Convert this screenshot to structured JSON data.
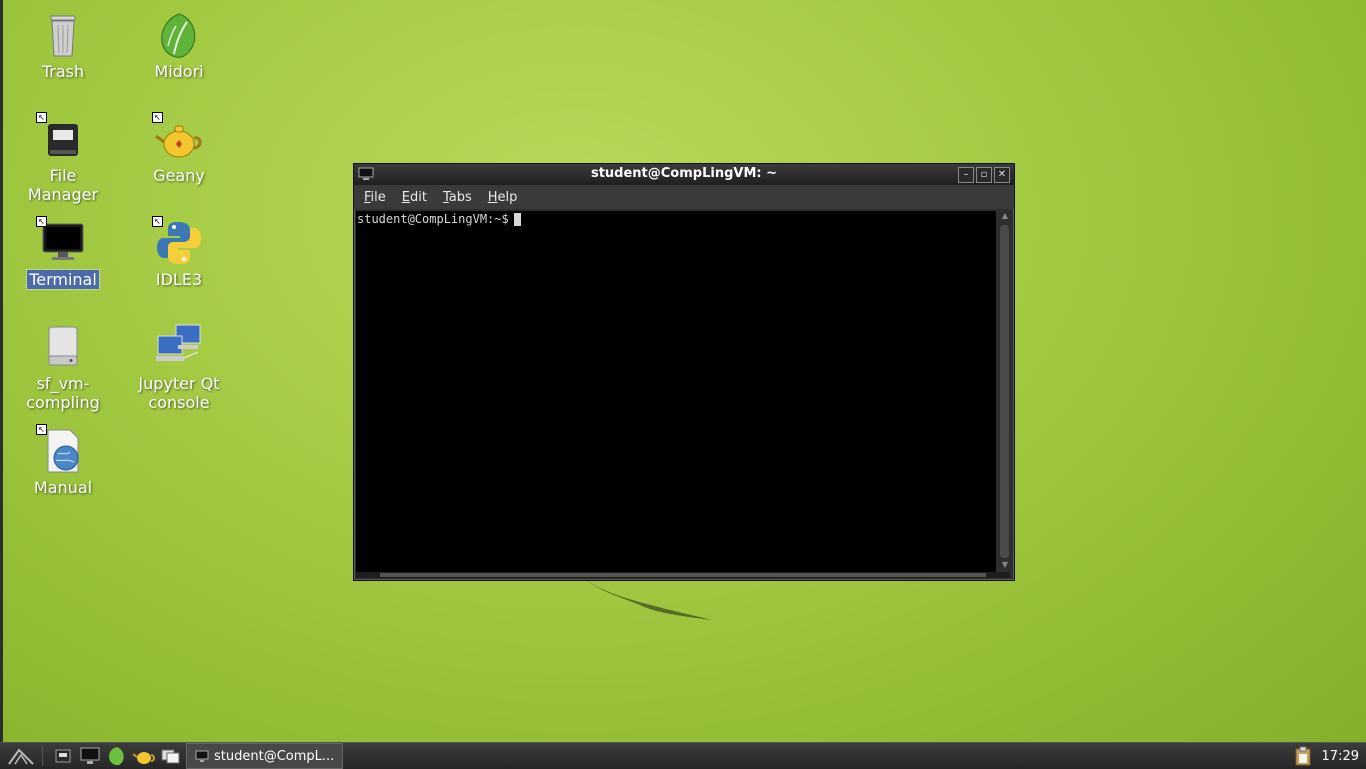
{
  "desktop": {
    "icons": [
      {
        "label": "Trash"
      },
      {
        "label": "Midori"
      },
      {
        "label": "File Manager"
      },
      {
        "label": "Geany"
      },
      {
        "label": "Terminal"
      },
      {
        "label": "IDLE3"
      },
      {
        "label": "sf_vm-compling"
      },
      {
        "label": "Jupyter Qt console"
      },
      {
        "label": "Manual"
      }
    ]
  },
  "terminal": {
    "title": "student@CompLingVM: ~",
    "menu": [
      "File",
      "Edit",
      "Tabs",
      "Help"
    ],
    "prompt": "student@CompLingVM:~$"
  },
  "taskbar": {
    "task_label": "student@CompL...",
    "clock": "17:29"
  },
  "colors": {
    "desktop_bg": "#a7cc47",
    "selection": "#4a6aa8",
    "terminal_bg": "#000000"
  }
}
